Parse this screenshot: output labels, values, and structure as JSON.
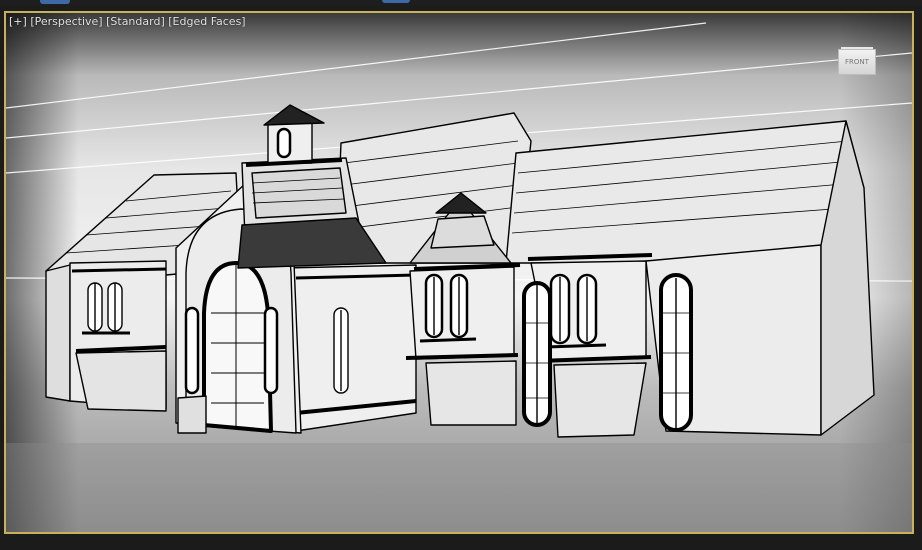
{
  "viewport": {
    "label_open": "[+]",
    "label_view": "[Perspective]",
    "label_shading": "[Standard]",
    "label_edges": "[Edged Faces]"
  },
  "viewcube": {
    "face_label": "FRONT",
    "icon": "viewcube-icon"
  },
  "colors": {
    "frame_active": "#c7b15a",
    "top_tick": "#3d6aa6",
    "model_fill": "#e8e8e8",
    "model_edge": "#000000"
  }
}
